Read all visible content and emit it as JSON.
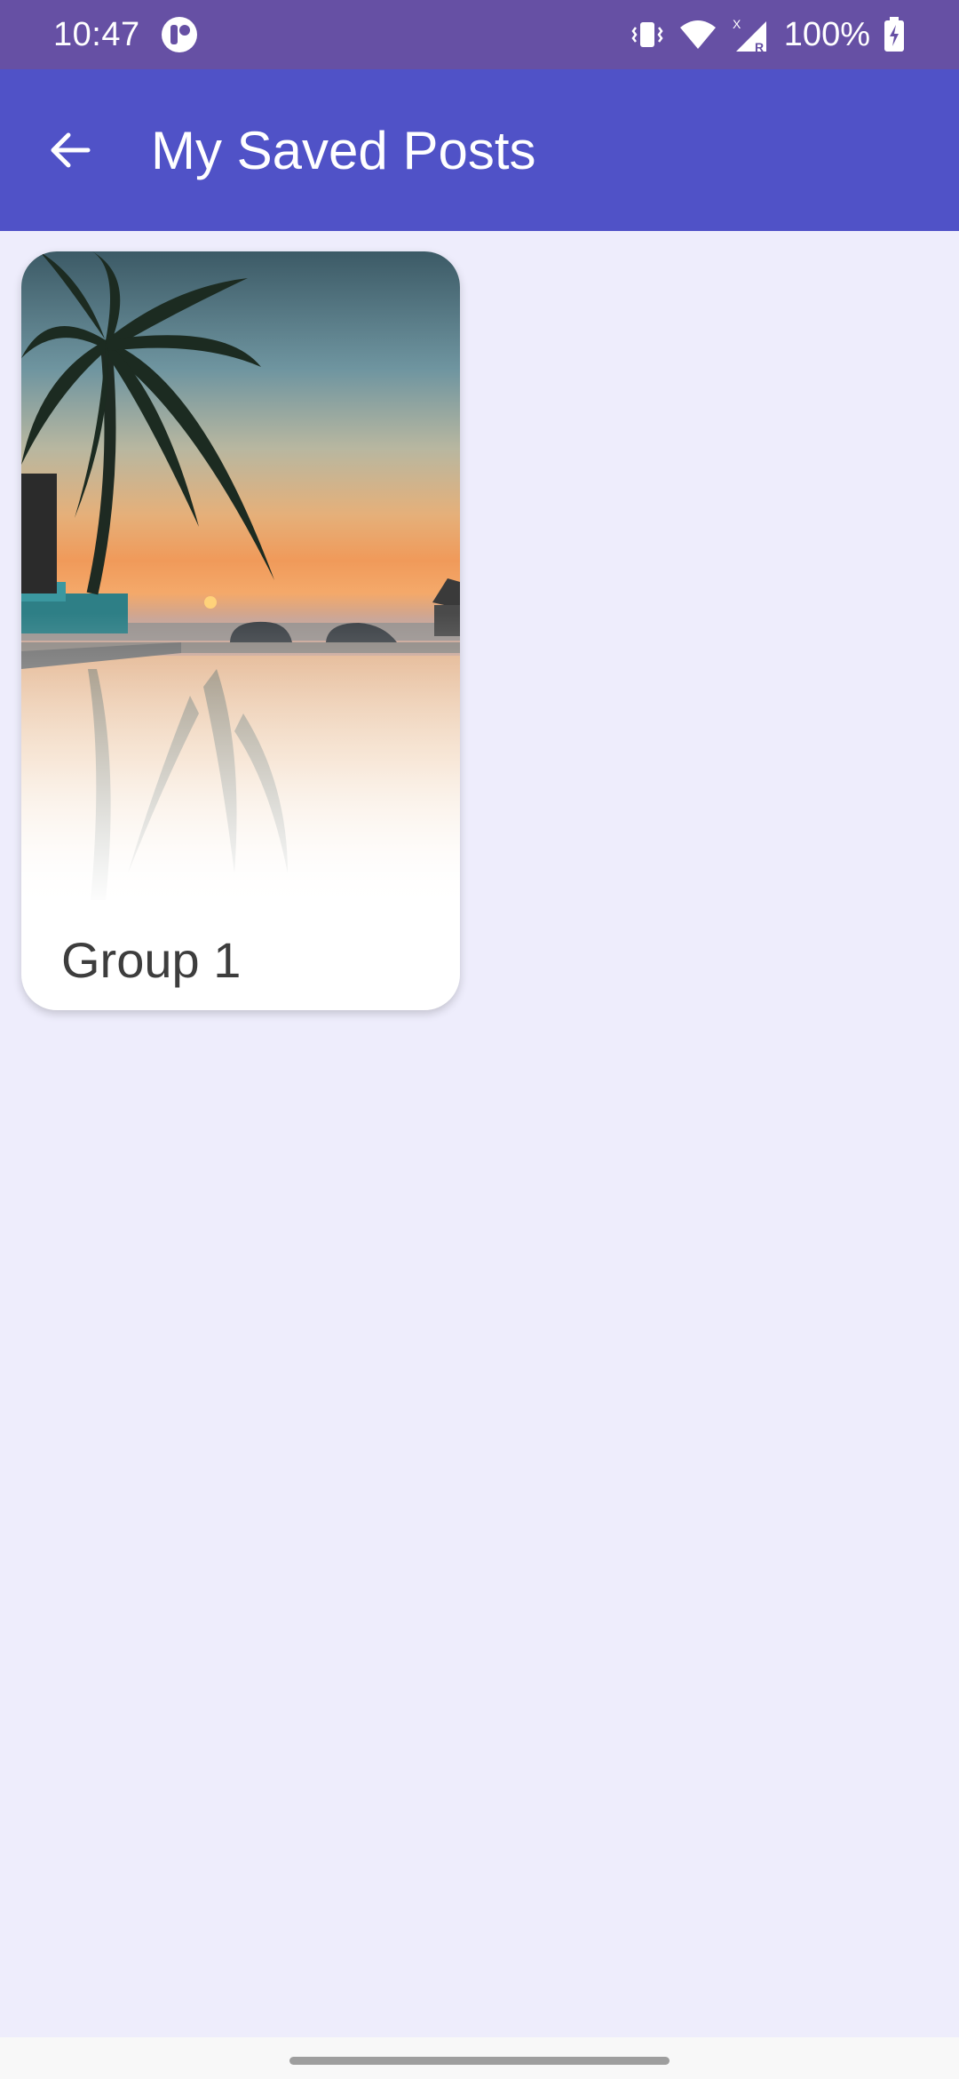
{
  "status_bar": {
    "time": "10:47",
    "battery": "100%",
    "network_label": "R",
    "roaming_label": "X"
  },
  "app_bar": {
    "title": "My Saved Posts"
  },
  "groups": [
    {
      "label": "Group 1",
      "image": "palm-sunset-pool-photo"
    }
  ],
  "colors": {
    "status_bar": "#6650a4",
    "app_bar": "#5052c7",
    "background": "#eeedfc",
    "card": "#ffffff"
  }
}
